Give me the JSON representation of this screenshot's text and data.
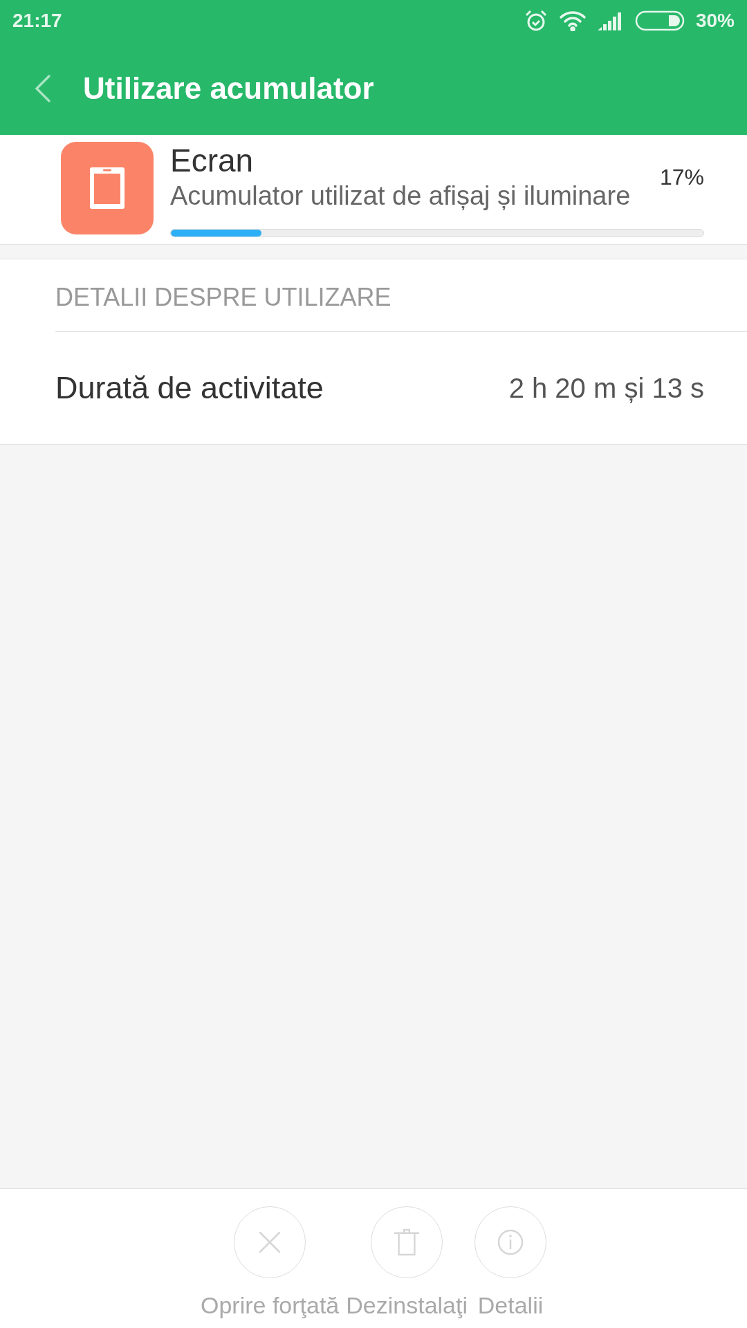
{
  "status_bar": {
    "time": "21:17",
    "battery_level": "30%"
  },
  "app_bar": {
    "title": "Utilizare acumulator"
  },
  "usage_item": {
    "name": "Ecran",
    "description": "Acumulator utilizat de afișaj și iluminare",
    "percent": "17%",
    "level": 0.17
  },
  "details": {
    "header": "DETALII DESPRE UTILIZARE",
    "rows": [
      {
        "label": "Durată de activitate",
        "value": "2 h 20 m și 13 s"
      }
    ]
  },
  "actions": [
    {
      "kind": "stop",
      "label": "Oprire forţată",
      "disabled": true
    },
    {
      "kind": "uninstall",
      "label": "Dezinstalaţi",
      "disabled": true
    },
    {
      "kind": "info",
      "label": "Detalii",
      "disabled": true
    }
  ]
}
